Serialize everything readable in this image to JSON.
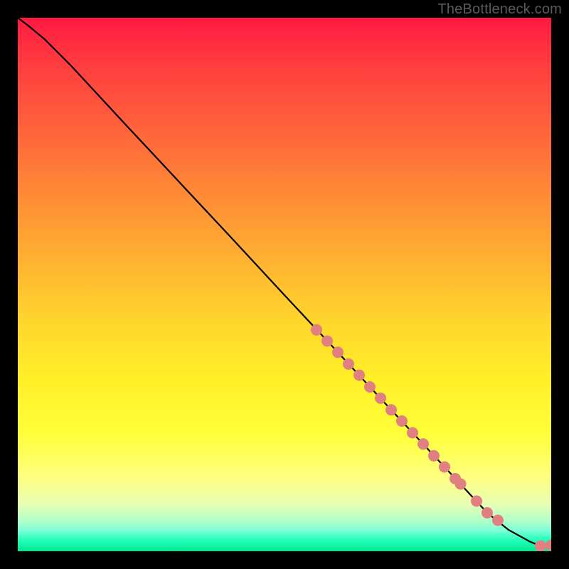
{
  "watermark": "TheBottleneck.com",
  "colors": {
    "page_bg": "#000000",
    "gradient_top": "#ff1a42",
    "gradient_mid": "#fff028",
    "gradient_bottom": "#00e890",
    "curve": "#000000",
    "marker_fill": "#e08080",
    "marker_stroke": "#c86868"
  },
  "chart_data": {
    "type": "line",
    "title": "",
    "xlabel": "",
    "ylabel": "",
    "xlim": [
      0,
      100
    ],
    "ylim": [
      0,
      100
    ],
    "grid": false,
    "legend": false,
    "annotations": [],
    "series": [
      {
        "name": "curve",
        "type": "line",
        "x": [
          0,
          2,
          5,
          10,
          20,
          30,
          40,
          50,
          60,
          70,
          80,
          88,
          92,
          96,
          98,
          99,
          100
        ],
        "y": [
          100,
          98.5,
          96,
          91,
          80.2,
          69.5,
          58.8,
          48.0,
          37.3,
          26.5,
          15.8,
          7.2,
          4.0,
          1.8,
          1.0,
          0.9,
          1.1
        ]
      },
      {
        "name": "points",
        "type": "scatter",
        "x": [
          56,
          58,
          60,
          62,
          64,
          66,
          68,
          70,
          72,
          74,
          76,
          78,
          80,
          82,
          83,
          86,
          88,
          90,
          98,
          100
        ],
        "y": [
          41.5,
          39.4,
          37.3,
          35.1,
          33.0,
          30.8,
          28.7,
          26.5,
          24.4,
          22.2,
          20.1,
          17.9,
          15.8,
          13.6,
          12.6,
          9.4,
          7.2,
          5.8,
          1.0,
          1.1
        ]
      }
    ]
  }
}
